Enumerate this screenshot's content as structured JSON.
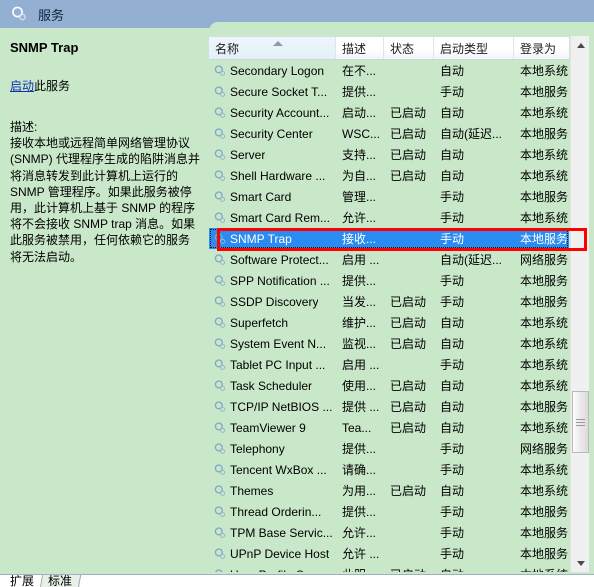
{
  "window": {
    "title": "服务",
    "icon": "services-gear-icon"
  },
  "details": {
    "service_name": "SNMP Trap",
    "action_link": "启动",
    "action_suffix": "此服务",
    "description_label": "描述:",
    "description_text": "接收本地或远程简单网络管理协议 (SNMP) 代理程序生成的陷阱消息并将消息转发到此计算机上运行的 SNMP 管理程序。如果此服务被停用，此计算机上基于 SNMP 的程序将不会接收 SNMP trap 消息。如果此服务被禁用，任何依赖它的服务将无法启动。"
  },
  "list": {
    "columns": [
      "名称",
      "描述",
      "状态",
      "启动类型",
      "登录为"
    ],
    "sort_column": "名称",
    "sort_direction": "ascending",
    "rows": [
      {
        "name": "Secondary Logon",
        "desc": "在不...",
        "status": "",
        "startup": "自动",
        "logon": "本地系统",
        "selected": false
      },
      {
        "name": "Secure Socket T...",
        "desc": "提供...",
        "status": "",
        "startup": "手动",
        "logon": "本地服务",
        "selected": false
      },
      {
        "name": "Security Account...",
        "desc": "启动...",
        "status": "已启动",
        "startup": "自动",
        "logon": "本地系统",
        "selected": false
      },
      {
        "name": "Security Center",
        "desc": "WSC...",
        "status": "已启动",
        "startup": "自动(延迟...",
        "logon": "本地服务",
        "selected": false
      },
      {
        "name": "Server",
        "desc": "支持...",
        "status": "已启动",
        "startup": "自动",
        "logon": "本地系统",
        "selected": false
      },
      {
        "name": "Shell Hardware ...",
        "desc": "为自...",
        "status": "已启动",
        "startup": "自动",
        "logon": "本地系统",
        "selected": false
      },
      {
        "name": "Smart Card",
        "desc": "管理...",
        "status": "",
        "startup": "手动",
        "logon": "本地服务",
        "selected": false
      },
      {
        "name": "Smart Card Rem...",
        "desc": "允许...",
        "status": "",
        "startup": "手动",
        "logon": "本地系统",
        "selected": false
      },
      {
        "name": "SNMP Trap",
        "desc": "接收...",
        "status": "",
        "startup": "手动",
        "logon": "本地服务",
        "selected": true
      },
      {
        "name": "Software Protect...",
        "desc": "启用 ...",
        "status": "",
        "startup": "自动(延迟...",
        "logon": "网络服务",
        "selected": false
      },
      {
        "name": "SPP Notification ...",
        "desc": "提供...",
        "status": "",
        "startup": "手动",
        "logon": "本地服务",
        "selected": false
      },
      {
        "name": "SSDP Discovery",
        "desc": "当发...",
        "status": "已启动",
        "startup": "手动",
        "logon": "本地服务",
        "selected": false
      },
      {
        "name": "Superfetch",
        "desc": "维护...",
        "status": "已启动",
        "startup": "自动",
        "logon": "本地系统",
        "selected": false
      },
      {
        "name": "System Event N...",
        "desc": "监视...",
        "status": "已启动",
        "startup": "自动",
        "logon": "本地系统",
        "selected": false
      },
      {
        "name": "Tablet PC Input ...",
        "desc": "启用 ...",
        "status": "",
        "startup": "手动",
        "logon": "本地系统",
        "selected": false
      },
      {
        "name": "Task Scheduler",
        "desc": "使用...",
        "status": "已启动",
        "startup": "自动",
        "logon": "本地系统",
        "selected": false
      },
      {
        "name": "TCP/IP NetBIOS ...",
        "desc": "提供 ...",
        "status": "已启动",
        "startup": "自动",
        "logon": "本地服务",
        "selected": false
      },
      {
        "name": "TeamViewer 9",
        "desc": "Tea...",
        "status": "已启动",
        "startup": "自动",
        "logon": "本地系统",
        "selected": false
      },
      {
        "name": "Telephony",
        "desc": "提供...",
        "status": "",
        "startup": "手动",
        "logon": "网络服务",
        "selected": false
      },
      {
        "name": "Tencent WxBox ...",
        "desc": "请确...",
        "status": "",
        "startup": "手动",
        "logon": "本地系统",
        "selected": false
      },
      {
        "name": "Themes",
        "desc": "为用...",
        "status": "已启动",
        "startup": "自动",
        "logon": "本地系统",
        "selected": false
      },
      {
        "name": "Thread Orderin...",
        "desc": "提供...",
        "status": "",
        "startup": "手动",
        "logon": "本地服务",
        "selected": false
      },
      {
        "name": "TPM Base Servic...",
        "desc": "允许...",
        "status": "",
        "startup": "手动",
        "logon": "本地服务",
        "selected": false
      },
      {
        "name": "UPnP Device Host",
        "desc": "允许 ...",
        "status": "",
        "startup": "手动",
        "logon": "本地服务",
        "selected": false
      },
      {
        "name": "User Profile Serv...",
        "desc": "此服...",
        "status": "已启动",
        "startup": "自动",
        "logon": "本地系统",
        "selected": false
      }
    ]
  },
  "scrollbar": {
    "up_arrow": "scroll-up-icon",
    "down_arrow": "scroll-down-icon"
  },
  "tabs": [
    {
      "label": "扩展",
      "active": false
    },
    {
      "label": "标准",
      "active": true
    }
  ],
  "colors": {
    "titlebar": "#93b0d3",
    "pane_background": "#c9e8c9",
    "selection": "#2a8bf0",
    "annotation": "#ff0000",
    "link": "#0d31b0"
  }
}
